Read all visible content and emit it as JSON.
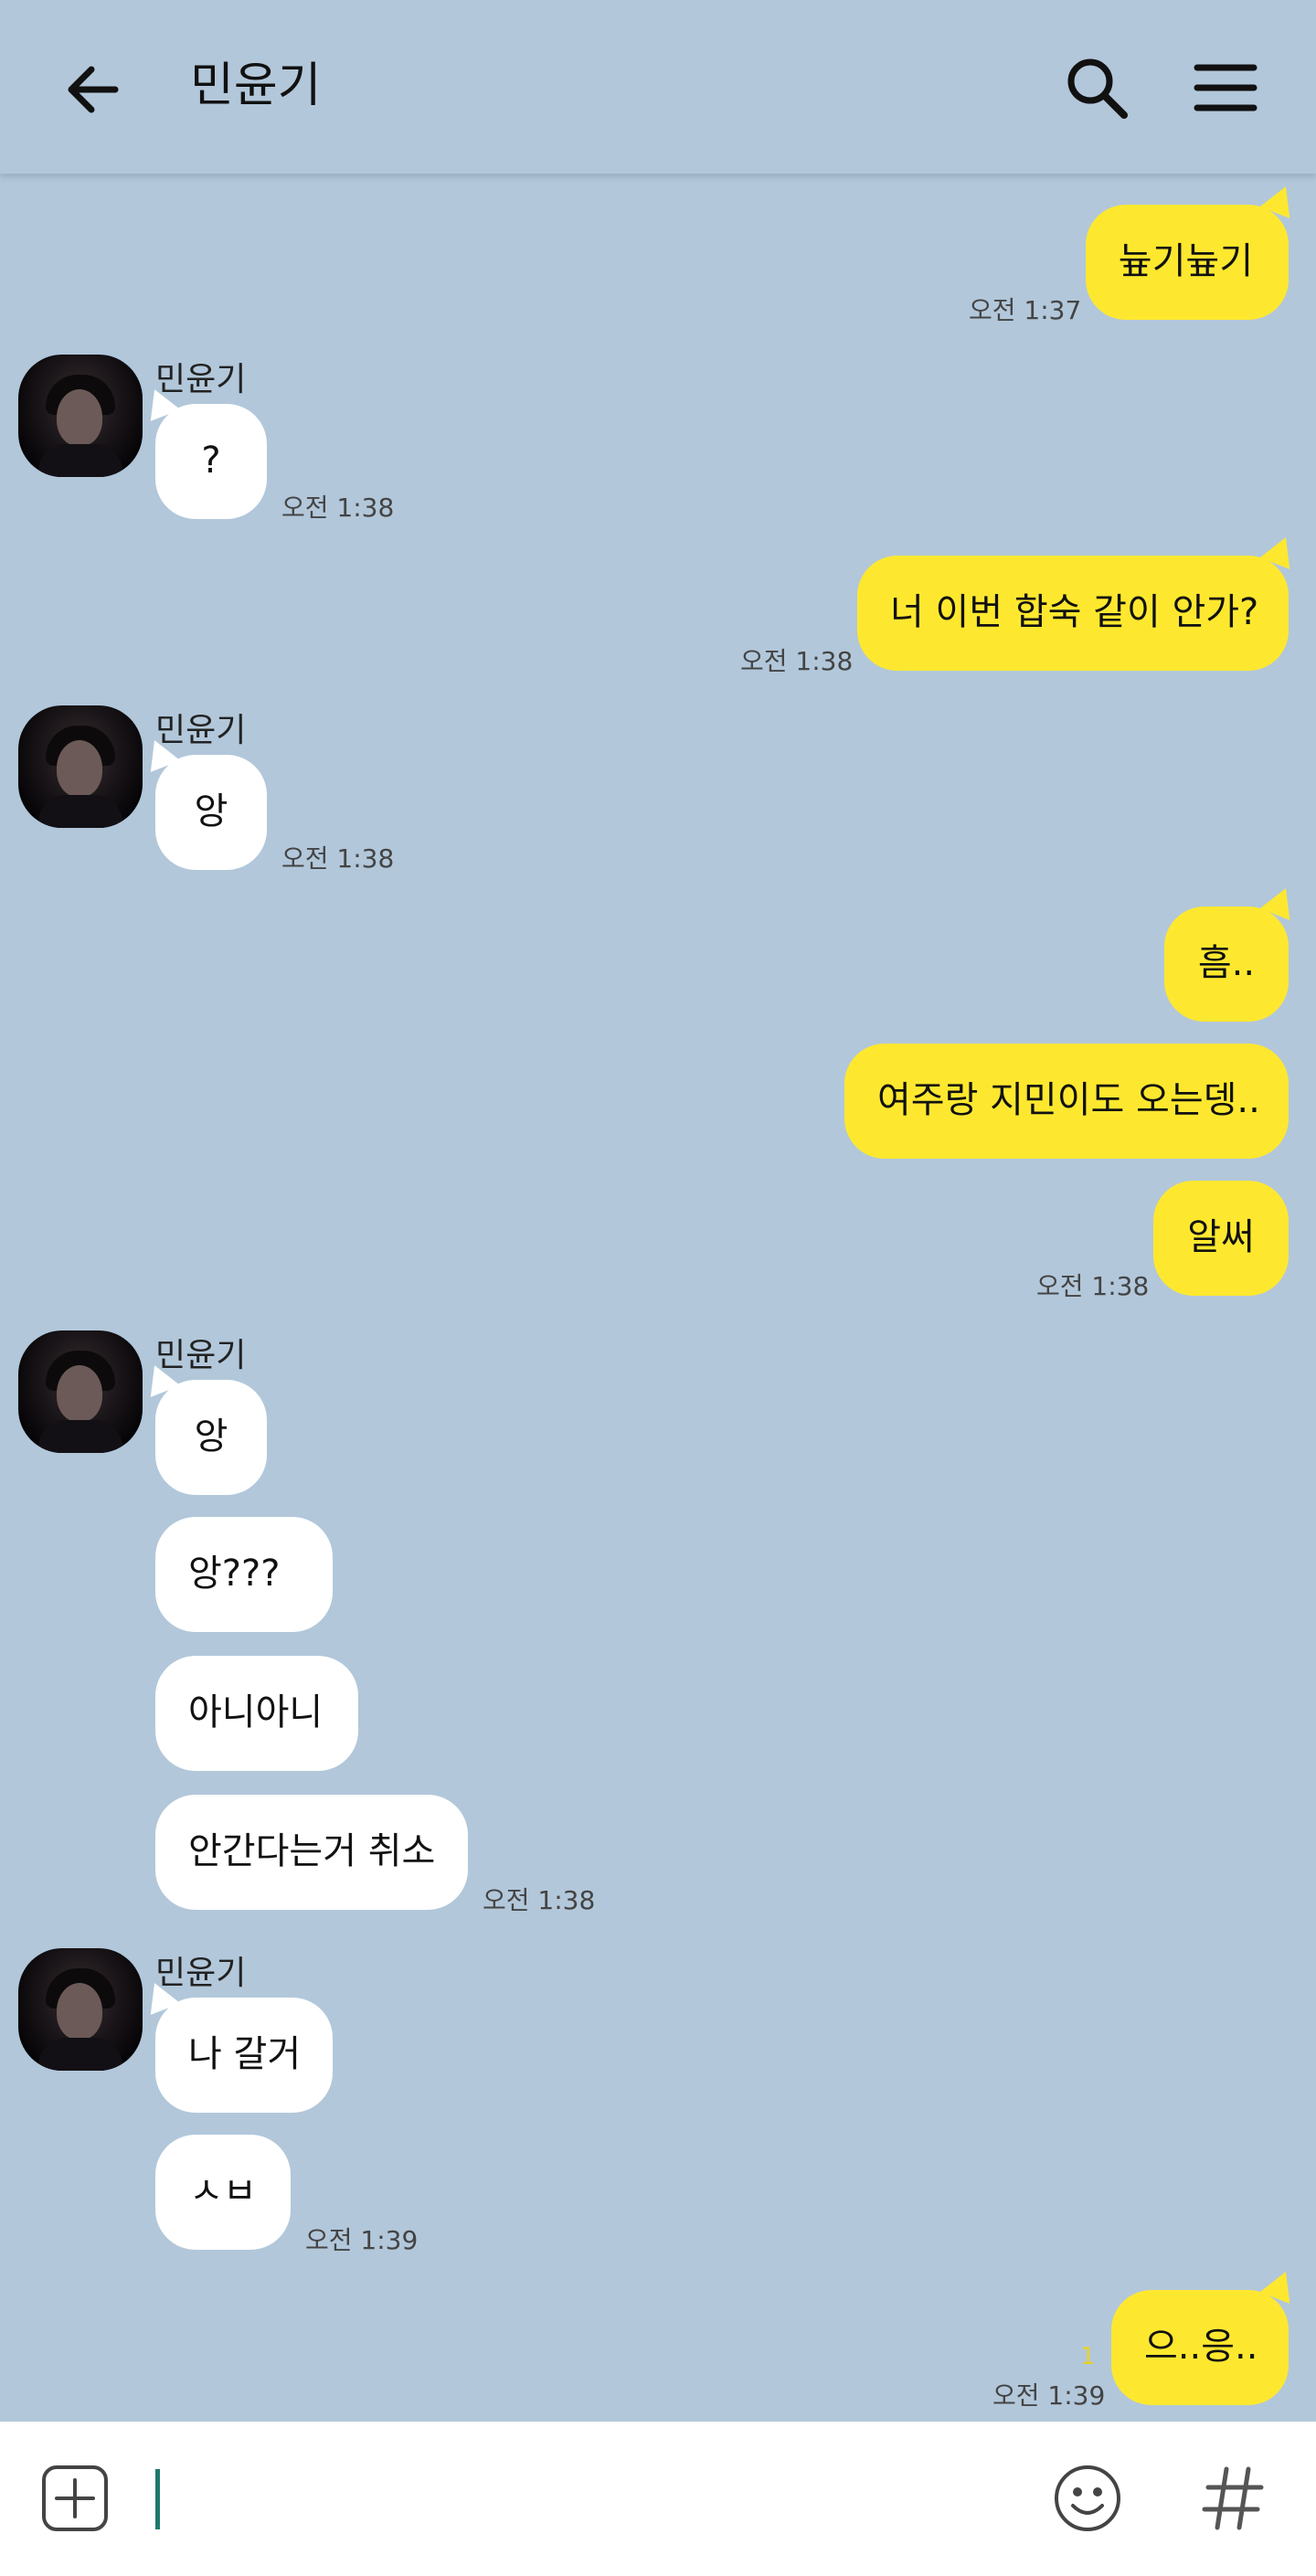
{
  "header": {
    "title": "민윤기",
    "back_icon": "arrow-left-icon",
    "search_icon": "search-icon",
    "menu_icon": "menu-icon"
  },
  "contact_name": "민윤기",
  "messages": {
    "m1": {
      "text": "늎기늎기",
      "time": "오전 1:37"
    },
    "t1": {
      "text": "?",
      "time": "오전 1:38"
    },
    "m2": {
      "text": "너 이번 합숙 같이 안가?",
      "time": "오전 1:38"
    },
    "t2": {
      "text": "앙",
      "time": "오전 1:38"
    },
    "m3": {
      "text": "흠.."
    },
    "m4": {
      "text": "여주랑 지민이도 오는뎅.."
    },
    "m5": {
      "text": "알써",
      "time": "오전 1:38"
    },
    "t3": {
      "text": "앙"
    },
    "t4": {
      "text": "앙???"
    },
    "t5": {
      "text": "아니아니"
    },
    "t6": {
      "text": "안간다는거 취소",
      "time": "오전 1:38"
    },
    "t7": {
      "text": "나 갈거"
    },
    "t8": {
      "text": "ㅅㅂ",
      "time": "오전 1:39"
    },
    "m6": {
      "text": "으..응..",
      "time": "오전 1:39",
      "unread": "1"
    }
  },
  "input": {
    "plus_icon": "plus-square-icon",
    "emoji_icon": "emoji-icon",
    "hash_icon": "hash-icon"
  },
  "colors": {
    "background": "#b2c7da",
    "my_bubble": "#fee82f",
    "their_bubble": "#ffffff",
    "cursor": "#1d7a6c"
  }
}
